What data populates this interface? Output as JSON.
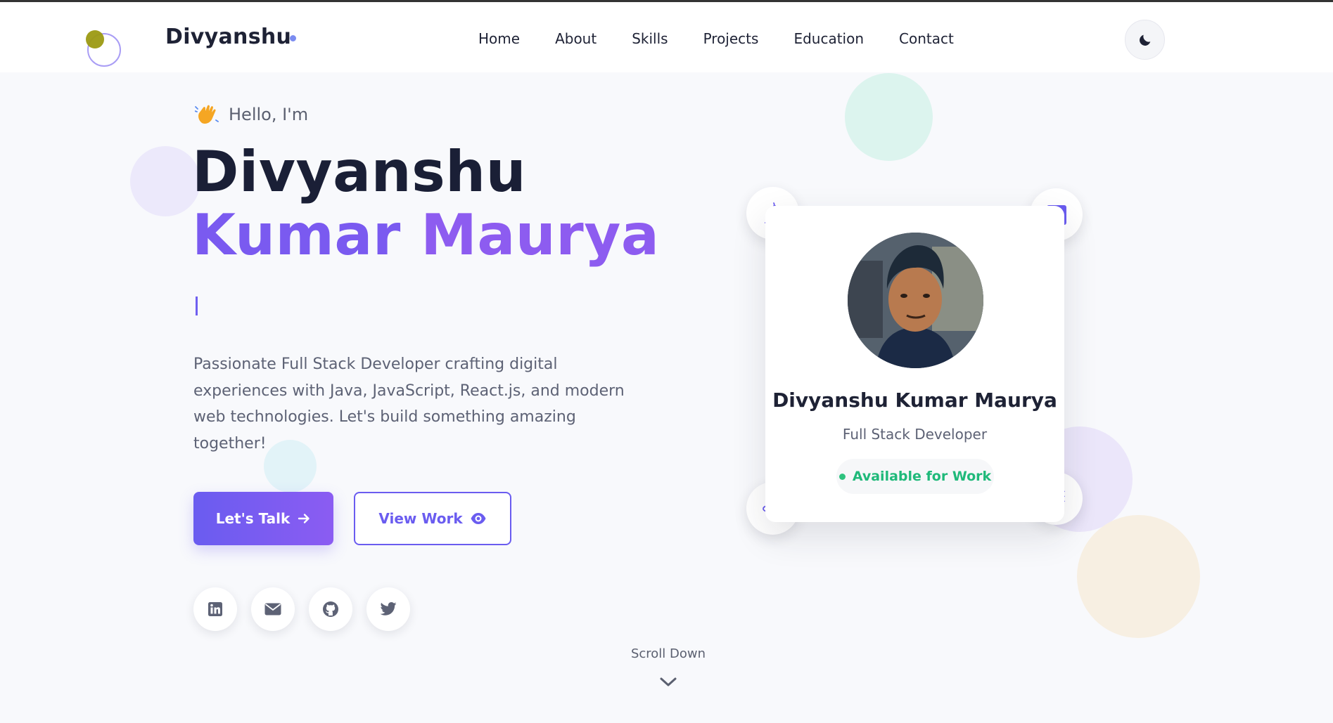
{
  "nav": {
    "brand": "Divyanshu",
    "links": [
      "Home",
      "About",
      "Skills",
      "Projects",
      "Education",
      "Contact"
    ],
    "theme_icon": "moon-icon"
  },
  "hero": {
    "greeting_icon": "waving-hand-icon",
    "greeting": "Hello, I'm",
    "first_name": "Divyanshu",
    "last_name_1": "Kumar",
    "last_name_2": "Maurya",
    "bio": "Passionate Full Stack Developer crafting digital experiences with Java, JavaScript, React.js, and modern web technologies. Let's build something amazing together!",
    "primary_button": "Let's Talk",
    "secondary_button": "View Work",
    "socials": [
      "linkedin-icon",
      "mail-icon",
      "github-icon",
      "twitter-icon"
    ]
  },
  "profile_card": {
    "name": "Divyanshu Kumar Maurya",
    "role": "Full Stack Developer",
    "status": "Available for Work",
    "badges": [
      "java-icon",
      "javascript-icon",
      "react-icon",
      "database-icon"
    ]
  },
  "scroll": {
    "label": "Scroll Down"
  },
  "colors": {
    "accent": "#6a5cf0",
    "accent_light": "#8b5cf2",
    "status": "#1fb97a",
    "text_dark": "#1e2235"
  }
}
